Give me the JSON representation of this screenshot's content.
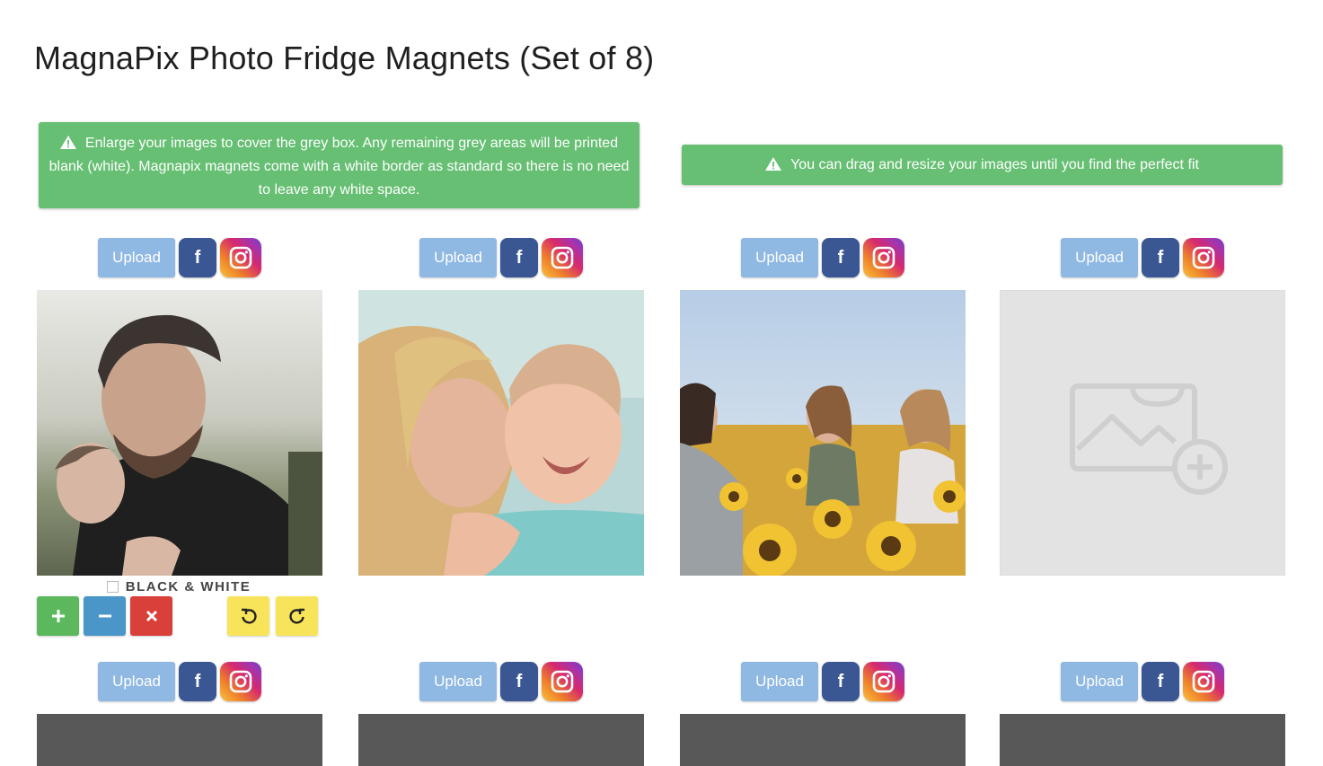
{
  "page": {
    "title": "MagnaPix Photo Fridge Magnets (Set of 8)"
  },
  "alerts": [
    {
      "icon": "warning-icon",
      "text": "Enlarge your images to cover the grey box. Any remaining grey areas will be printed blank (white). Magnapix magnets come with a white border as standard so there is no need to leave any white space."
    },
    {
      "icon": "warning-icon",
      "text": "You can drag and resize your images until you find the perfect fit"
    }
  ],
  "slots": [
    {
      "upload_label": "Upload",
      "facebook_label": "f",
      "image": "photo-father-daughter",
      "state": "filled"
    },
    {
      "upload_label": "Upload",
      "facebook_label": "f",
      "image": "photo-mother-baby",
      "state": "filled"
    },
    {
      "upload_label": "Upload",
      "facebook_label": "f",
      "image": "photo-sunflower-friends",
      "state": "filled"
    },
    {
      "upload_label": "Upload",
      "facebook_label": "f",
      "image": "add-image-placeholder",
      "state": "empty"
    },
    {
      "upload_label": "Upload",
      "facebook_label": "f",
      "state": "dark"
    },
    {
      "upload_label": "Upload",
      "facebook_label": "f",
      "state": "dark"
    },
    {
      "upload_label": "Upload",
      "facebook_label": "f",
      "state": "dark"
    },
    {
      "upload_label": "Upload",
      "facebook_label": "f",
      "state": "dark"
    }
  ],
  "editor": {
    "black_white_label": "BLACK & WHITE",
    "black_white_checked": false,
    "tools": [
      "zoom-in-icon",
      "zoom-out-icon",
      "remove-icon",
      "rotate-left-icon",
      "rotate-right-icon"
    ]
  },
  "colors": {
    "alert_green": "#66bf73",
    "upload_blue": "#8fb8e3",
    "facebook_blue": "#3a5794",
    "zoom_in_green": "#5cb85c",
    "zoom_out_blue": "#4a96c9",
    "remove_red": "#d9403a",
    "rotate_yellow": "#f8e45a",
    "placeholder_grey": "#e3e3e3",
    "empty_dark": "#585858"
  }
}
